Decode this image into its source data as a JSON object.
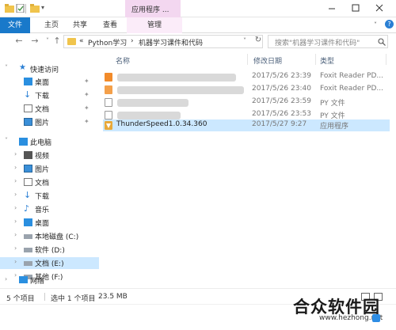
{
  "titlebar": {
    "context_tab": "应用程序 ...",
    "controls": [
      "minimize-icon",
      "maximize-icon",
      "close-icon"
    ]
  },
  "ribbon": {
    "file": "文件",
    "home": "主页",
    "share": "共享",
    "view": "查看",
    "manage": "管理"
  },
  "address": {
    "prefix": "«",
    "crumb1": "Python学习",
    "arrow": "›",
    "crumb2": "机器学习课件和代码",
    "search_placeholder": "搜索\"机器学习课件和代码\""
  },
  "nav": {
    "quick_access": "快速访问",
    "desktop": "桌面",
    "downloads": "下载",
    "documents": "文档",
    "pictures": "图片",
    "this_pc": "此电脑",
    "videos": "视频",
    "pictures2": "图片",
    "documents2": "文档",
    "downloads2": "下载",
    "music": "音乐",
    "desktop2": "桌面",
    "local_c": "本地磁盘 (C:)",
    "soft_d": "软件 (D:)",
    "doc_e": "文档 (E:)",
    "other_f": "其他 (F:)",
    "network": "网络"
  },
  "columns": {
    "name": "名称",
    "modified": "修改日期",
    "type": "类型"
  },
  "files": [
    {
      "name": "",
      "date": "2017/5/26 23:39",
      "type": "Foxit Reader PD..."
    },
    {
      "name": "",
      "date": "2017/5/26 23:40",
      "type": "Foxit Reader PD..."
    },
    {
      "name": "",
      "date": "2017/5/26 23:59",
      "type": "PY 文件"
    },
    {
      "name": "",
      "date": "2017/5/26 23:53",
      "type": "PY 文件"
    },
    {
      "name": "ThunderSpeed1.0.34.360",
      "date": "2017/5/27 9:27",
      "type": "应用程序"
    }
  ],
  "status": {
    "count": "5 个项目",
    "selected": "选中 1 个项目",
    "size": "23.5 MB"
  },
  "watermark": {
    "title": "合众软件园",
    "url": "www.hezhong.net"
  },
  "colors": {
    "accent": "#1979ca",
    "selection": "#cce8ff",
    "folder": "#f0c44c"
  }
}
